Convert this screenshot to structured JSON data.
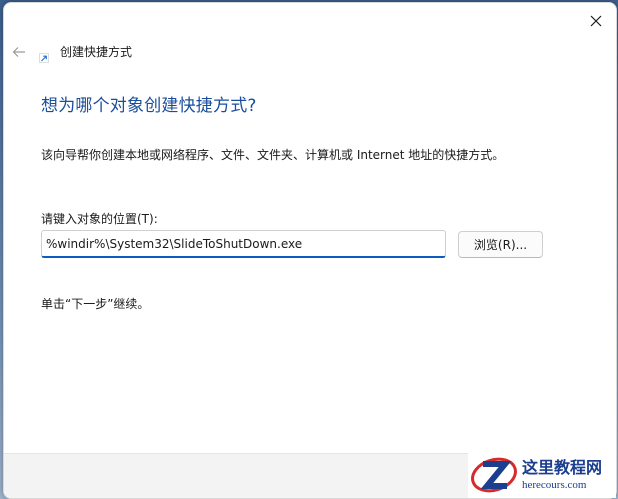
{
  "window": {
    "title": "创建快捷方式",
    "heading": "想为哪个对象创建快捷方式?",
    "description": "该向导帮你创建本地或网络程序、文件、文件夹、计算机或 Internet 地址的快捷方式。",
    "location_label": "请键入对象的位置(T):",
    "location_value": "%windir%\\System32\\SlideToShutDown.exe",
    "browse_label": "浏览(R)...",
    "hint": "单击“下一步”继续。"
  },
  "watermark": {
    "title": "这里教程网",
    "url": "herecours.com"
  },
  "colors": {
    "heading": "#1a4e9c",
    "input_focus": "#0a5cbe",
    "watermark": "#1b3e8f",
    "watermark_accent": "#d62b2b"
  },
  "icons": {
    "close": "close-icon",
    "back": "arrow-left-icon",
    "shortcut": "shortcut-arrow-icon",
    "logo": "z-logo-icon"
  }
}
